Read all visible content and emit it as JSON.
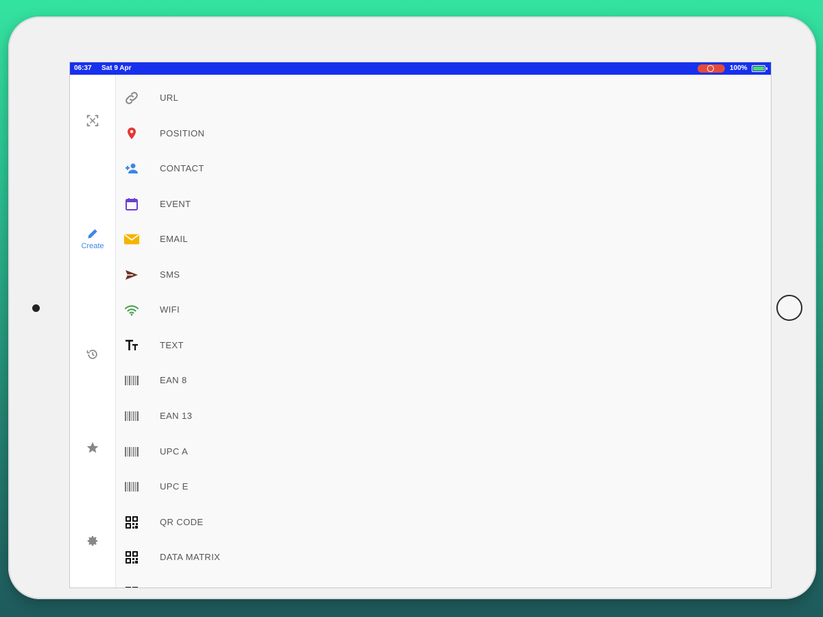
{
  "status_bar": {
    "time": "06:37",
    "date": "Sat 9 Apr",
    "battery": "100%",
    "color": "#1730ee"
  },
  "sidebar": {
    "items": [
      {
        "icon": "scan-icon",
        "label": ""
      },
      {
        "icon": "pencil-icon",
        "label": "Create",
        "active": true
      },
      {
        "icon": "history-icon",
        "label": ""
      },
      {
        "icon": "star-icon",
        "label": ""
      },
      {
        "icon": "gear-icon",
        "label": ""
      }
    ],
    "active_color": "#3d86e6"
  },
  "create_list": {
    "items": [
      {
        "label": "URL",
        "icon": "link-icon",
        "color": "#888888"
      },
      {
        "label": "POSITION",
        "icon": "location-pin-icon",
        "color": "#e53935"
      },
      {
        "label": "CONTACT",
        "icon": "add-contact-icon",
        "color": "#3d86e6"
      },
      {
        "label": "EVENT",
        "icon": "calendar-icon",
        "color": "#6a3fd1"
      },
      {
        "label": "EMAIL",
        "icon": "envelope-icon",
        "color": "#f4b400"
      },
      {
        "label": "SMS",
        "icon": "send-icon",
        "color": "#6d3326"
      },
      {
        "label": "WIFI",
        "icon": "wifi-icon",
        "color": "#43a047"
      },
      {
        "label": "TEXT",
        "icon": "text-icon",
        "color": "#111111"
      },
      {
        "label": "EAN 8",
        "icon": "barcode-icon",
        "color": "#777777"
      },
      {
        "label": "EAN 13",
        "icon": "barcode-icon",
        "color": "#777777"
      },
      {
        "label": "UPC A",
        "icon": "barcode-icon",
        "color": "#777777"
      },
      {
        "label": "UPC E",
        "icon": "barcode-icon",
        "color": "#777777"
      },
      {
        "label": "QR CODE",
        "icon": "qr-code-icon",
        "color": "#111111"
      },
      {
        "label": "DATA MATRIX",
        "icon": "qr-code-icon",
        "color": "#111111"
      }
    ]
  }
}
